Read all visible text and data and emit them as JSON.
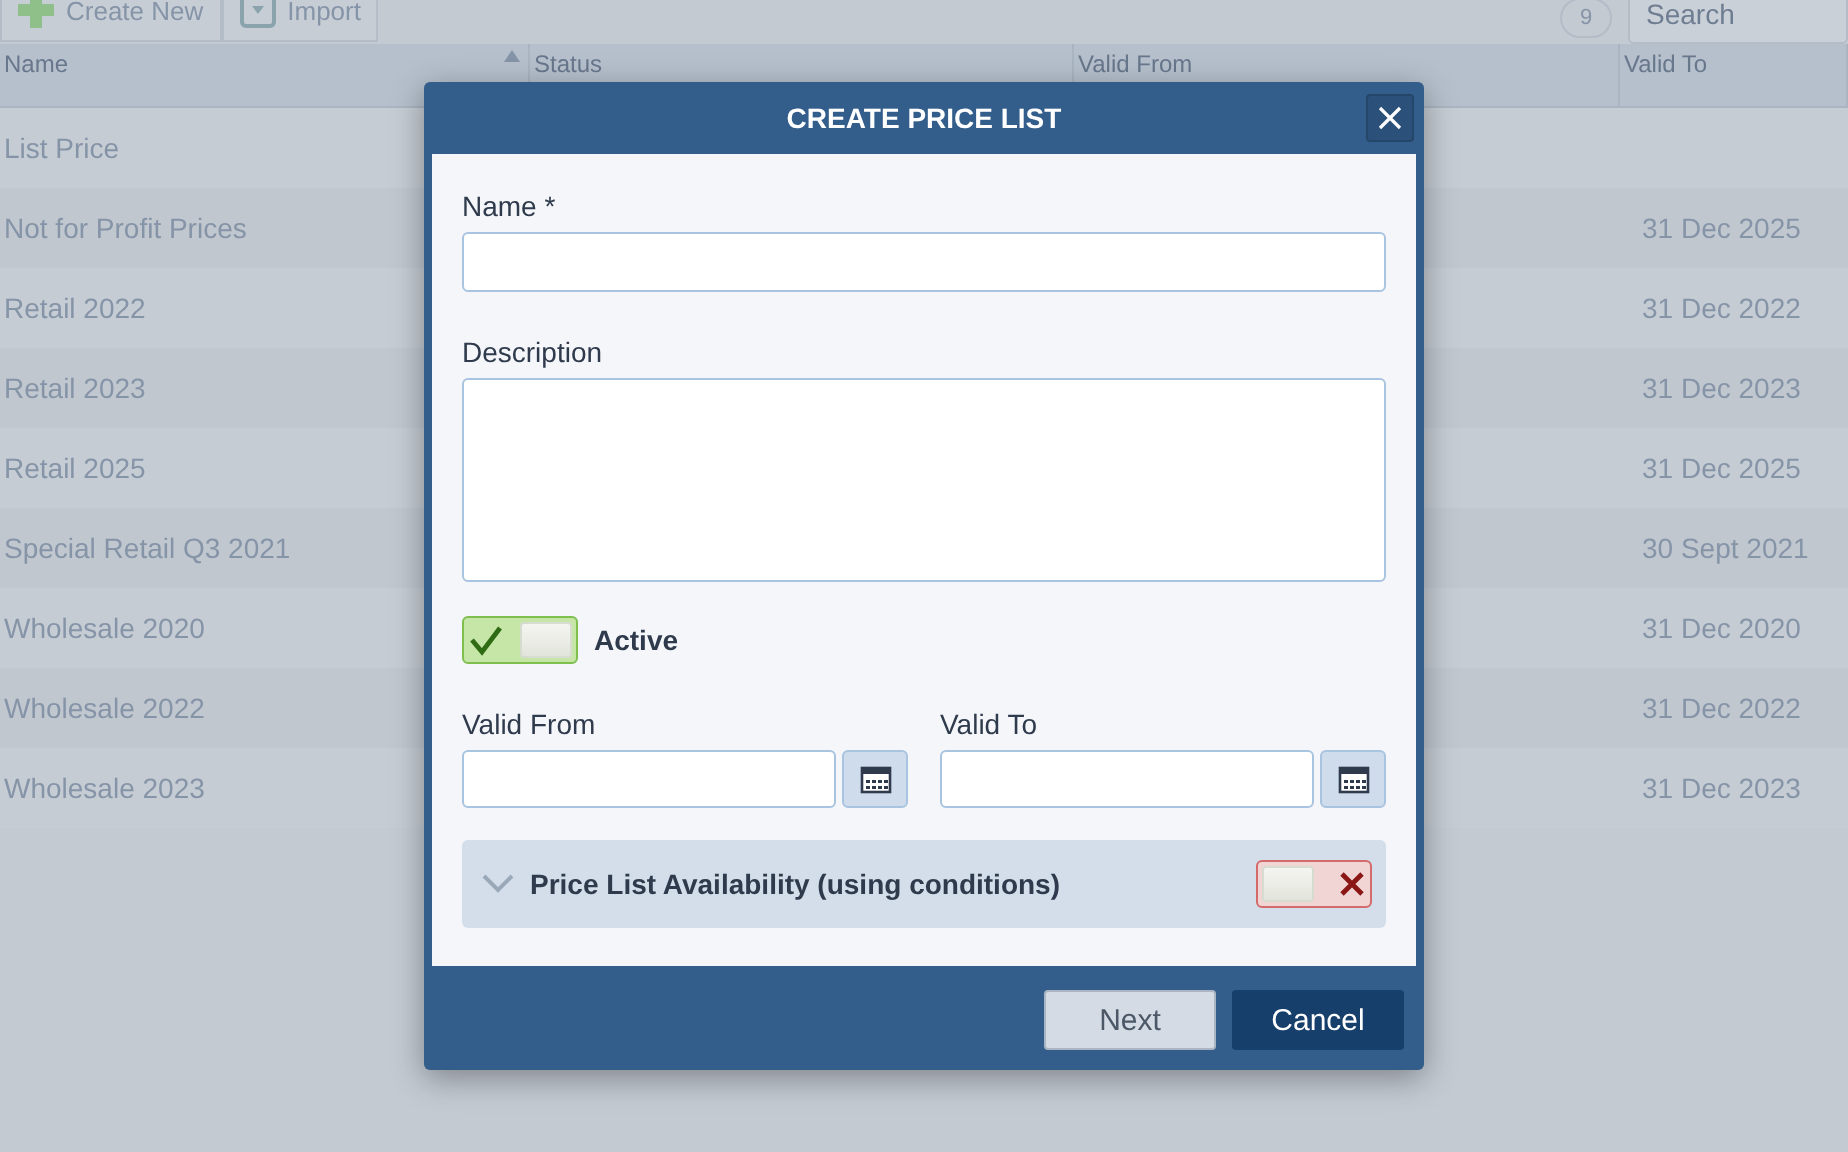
{
  "toolbar": {
    "buttons": [
      {
        "label": "Create New",
        "kind": "create"
      },
      {
        "label": "Import",
        "kind": "import"
      }
    ],
    "count": "9",
    "search": {
      "placeholder": "Search"
    }
  },
  "table": {
    "columns": [
      {
        "label": "Name",
        "sorted": true
      },
      {
        "label": "Status",
        "sorted": false
      },
      {
        "label": "Valid From",
        "sorted": false
      },
      {
        "label": "Valid To",
        "sorted": false
      }
    ],
    "rows": [
      {
        "name": "List Price",
        "valid_to": ""
      },
      {
        "name": "Not for Profit Prices",
        "valid_to": "31 Dec 2025"
      },
      {
        "name": "Retail 2022",
        "valid_to": "31 Dec 2022"
      },
      {
        "name": "Retail 2023",
        "valid_to": "31 Dec 2023"
      },
      {
        "name": "Retail 2025",
        "valid_to": "31 Dec 2025"
      },
      {
        "name": "Special Retail Q3 2021",
        "valid_to": "30 Sept 2021"
      },
      {
        "name": "Wholesale 2020",
        "valid_to": "31 Dec 2020"
      },
      {
        "name": "Wholesale 2022",
        "valid_to": "31 Dec 2022"
      },
      {
        "name": "Wholesale 2023",
        "valid_to": "31 Dec 2023"
      }
    ]
  },
  "dialog": {
    "title": "CREATE PRICE LIST",
    "name_label": "Name *",
    "description_label": "Description",
    "active": {
      "label": "Active",
      "on": true
    },
    "valid_from_label": "Valid From",
    "valid_to_label": "Valid To",
    "availability": {
      "label": "Price List Availability (using conditions)",
      "expanded": false,
      "on": false
    },
    "buttons": [
      {
        "label": "Next",
        "kind": "secondary"
      },
      {
        "label": "Cancel",
        "kind": "primary"
      }
    ]
  }
}
